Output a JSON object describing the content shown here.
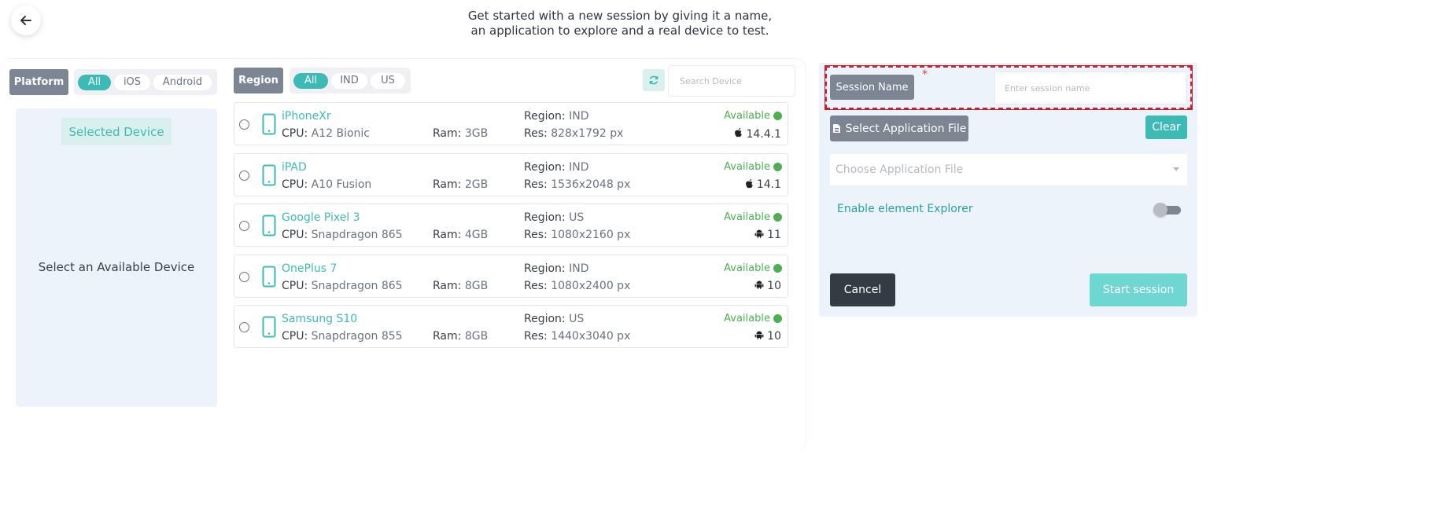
{
  "header": {
    "intro_line1": "Get started with a new session by giving it a name,",
    "intro_line2": "an application to explore and a real device to test."
  },
  "filters": {
    "platform_label": "Platform",
    "platform_options": [
      "All",
      "iOS",
      "Android"
    ],
    "platform_selected": "All",
    "region_label": "Region",
    "region_options": [
      "All",
      "IND",
      "US"
    ],
    "region_selected": "All"
  },
  "selected_panel": {
    "title": "Selected Device",
    "empty_text": "Select an Available Device"
  },
  "search": {
    "placeholder": "Search Device",
    "value": ""
  },
  "labels": {
    "cpu": "CPU:",
    "ram": "Ram:",
    "region": "Region:",
    "res": "Res:"
  },
  "devices": [
    {
      "name": "iPhoneXr",
      "cpu": "A12 Bionic",
      "ram": "3GB",
      "region": "IND",
      "res": "828x1792 px",
      "status": "Available",
      "os": "ios",
      "os_version": "14.4.1"
    },
    {
      "name": "iPAD",
      "cpu": "A10 Fusion",
      "ram": "2GB",
      "region": "IND",
      "res": "1536x2048 px",
      "status": "Available",
      "os": "ios",
      "os_version": "14.1"
    },
    {
      "name": "Google Pixel 3",
      "cpu": "Snapdragon 865",
      "ram": "4GB",
      "region": "US",
      "res": "1080x2160 px",
      "status": "Available",
      "os": "android",
      "os_version": "11"
    },
    {
      "name": "OnePlus 7",
      "cpu": "Snapdragon 865",
      "ram": "8GB",
      "region": "IND",
      "res": "1080x2400 px",
      "status": "Available",
      "os": "android",
      "os_version": "10"
    },
    {
      "name": "Samsung S10",
      "cpu": "Snapdragon 855",
      "ram": "8GB",
      "region": "US",
      "res": "1440x3040 px",
      "status": "Available",
      "os": "android",
      "os_version": "10"
    }
  ],
  "session_form": {
    "session_name_label": "Session Name",
    "required_marker": "*",
    "session_name_placeholder": "Enter session name",
    "session_name_value": "",
    "select_app_label": "Select Application File",
    "clear_label": "Clear",
    "choose_app_placeholder": "Choose Application File",
    "explorer_label": "Enable element Explorer",
    "explorer_enabled": false,
    "cancel_label": "Cancel",
    "start_label": "Start session"
  },
  "colors": {
    "accent": "#3dbab6",
    "available": "#4caf50",
    "chip_gray": "#7c8591",
    "required": "#e53935"
  },
  "icons": {
    "back": "arrow-left-icon",
    "refresh": "refresh-icon",
    "device": "phone-icon",
    "ios": "apple-icon",
    "android": "android-icon",
    "file": "file-icon",
    "dropdown": "chevron-down-icon"
  }
}
